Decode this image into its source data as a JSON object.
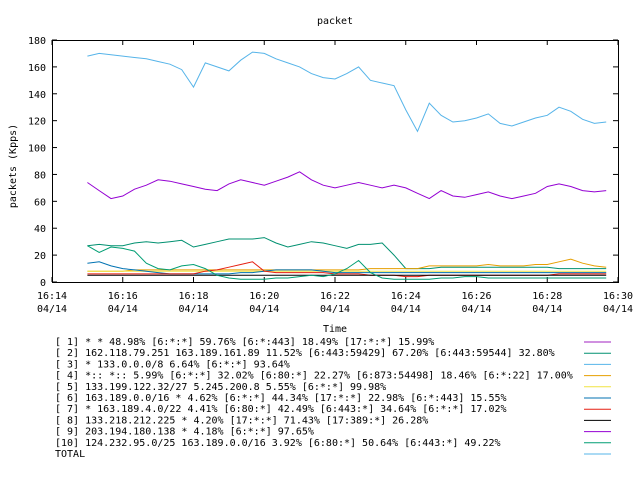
{
  "chart_data": {
    "type": "line",
    "title": "packet",
    "xlabel": "Time",
    "ylabel": "packets (Kpps)",
    "ylim": [
      0,
      180
    ],
    "yticks": [
      0,
      20,
      40,
      60,
      80,
      100,
      120,
      140,
      160,
      180
    ],
    "xlim": [
      "16:14",
      "16:30"
    ],
    "xticks": [
      {
        "time": "16:14",
        "date": "04/14"
      },
      {
        "time": "16:16",
        "date": "04/14"
      },
      {
        "time": "16:18",
        "date": "04/14"
      },
      {
        "time": "16:20",
        "date": "04/14"
      },
      {
        "time": "16:22",
        "date": "04/14"
      },
      {
        "time": "16:24",
        "date": "04/14"
      },
      {
        "time": "16:26",
        "date": "04/14"
      },
      {
        "time": "16:28",
        "date": "04/14"
      },
      {
        "time": "16:30",
        "date": "04/14"
      }
    ],
    "grid": false,
    "legend_position": "bottom",
    "x": [
      "16:15:00",
      "16:15:20",
      "16:15:40",
      "16:16:00",
      "16:16:20",
      "16:16:40",
      "16:17:00",
      "16:17:20",
      "16:17:40",
      "16:18:00",
      "16:18:20",
      "16:18:40",
      "16:19:00",
      "16:19:20",
      "16:19:40",
      "16:20:00",
      "16:20:20",
      "16:20:40",
      "16:21:00",
      "16:21:20",
      "16:21:40",
      "16:22:00",
      "16:22:20",
      "16:22:40",
      "16:23:00",
      "16:23:20",
      "16:23:40",
      "16:24:00",
      "16:24:20",
      "16:24:40",
      "16:25:00",
      "16:25:20",
      "16:25:40",
      "16:26:00",
      "16:26:20",
      "16:26:40",
      "16:27:00",
      "16:27:20",
      "16:27:40",
      "16:28:00",
      "16:28:20",
      "16:28:40",
      "16:29:00",
      "16:29:20",
      "16:29:40"
    ],
    "series": [
      {
        "name": "[ 1] * * 48.98%  [6:*:*] 59.76% [6:*:443] 18.49% [17:*:*] 15.99%",
        "color": "#a020c0",
        "values": [
          null,
          null,
          null,
          null,
          null,
          null,
          null,
          null,
          null,
          null,
          null,
          null,
          null,
          null,
          null,
          null,
          null,
          null,
          null,
          null,
          null,
          null,
          null,
          null,
          null,
          null,
          null,
          null,
          null,
          null,
          null,
          null,
          null,
          null,
          null,
          null,
          null,
          null,
          null,
          null,
          null,
          null,
          null,
          null,
          null
        ]
      },
      {
        "name": "[ 2] 162.118.79.251 163.189.161.89 11.52%  [6:443:59429] 67.20% [6:443:59544] 32.80%",
        "color": "#009070",
        "values": [
          27,
          28,
          27,
          27,
          29,
          30,
          29,
          30,
          31,
          26,
          28,
          30,
          32,
          32,
          32,
          33,
          29,
          26,
          28,
          30,
          29,
          27,
          25,
          28,
          28,
          29,
          20,
          10,
          10,
          10,
          11,
          11,
          11,
          11,
          11,
          11,
          11,
          11,
          11,
          11,
          10,
          10,
          10,
          10,
          10
        ]
      },
      {
        "name": "[ 3] * 133.0.0.0/8 6.64%  [6:*:*] 93.64%",
        "color": "#56b4e9",
        "values": [
          168,
          170,
          169,
          168,
          167,
          166,
          164,
          162,
          158,
          145,
          163,
          160,
          157,
          165,
          171,
          170,
          166,
          163,
          160,
          155,
          152,
          151,
          155,
          160,
          150,
          148,
          146,
          128,
          112,
          133,
          124,
          119,
          120,
          122,
          125,
          118,
          116,
          119,
          122,
          124,
          130,
          127,
          121,
          118,
          119
        ]
      },
      {
        "name": "[ 4] *:: *:: 5.99%  [6:*:*] 32.02% [6:80:*] 22.27% [6:873:54498] 18.46% [6:*:22] 17.00%",
        "color": "#e69f00",
        "values": [
          8,
          8,
          8,
          8,
          9,
          9,
          9,
          9,
          9,
          9,
          9,
          9,
          9,
          9,
          9,
          9,
          9,
          9,
          9,
          9,
          9,
          9,
          9,
          9,
          10,
          10,
          10,
          10,
          10,
          12,
          12,
          12,
          12,
          12,
          13,
          12,
          12,
          12,
          13,
          13,
          15,
          17,
          14,
          12,
          11
        ]
      },
      {
        "name": "[ 5] 133.199.122.32/27 5.245.200.8 5.55%  [6:*:*] 99.98%",
        "color": "#f0e442",
        "values": [
          8,
          8,
          8,
          8,
          8,
          8,
          8,
          8,
          8,
          8,
          8,
          8,
          8,
          8,
          8,
          8,
          8,
          8,
          8,
          8,
          8,
          8,
          8,
          8,
          8,
          8,
          8,
          8,
          8,
          8,
          8,
          8,
          8,
          8,
          8,
          8,
          8,
          8,
          8,
          8,
          8,
          8,
          8,
          8,
          8
        ]
      },
      {
        "name": "[ 6] 163.189.0.0/16 * 4.62%  [6:*:*] 44.34% [17:*:*] 22.98% [6:*:443] 15.55%",
        "color": "#0072b2",
        "values": [
          14,
          15,
          12,
          10,
          9,
          8,
          7,
          6,
          6,
          6,
          6,
          6,
          6,
          7,
          7,
          8,
          9,
          9,
          9,
          9,
          8,
          7,
          7,
          7,
          7,
          7,
          7,
          7,
          7,
          7,
          7,
          7,
          7,
          7,
          7,
          7,
          7,
          7,
          7,
          7,
          7,
          7,
          7,
          7,
          7
        ]
      },
      {
        "name": "[ 7] * 163.189.4.0/22 4.41%  [6:80:*] 42.49% [6:443:*] 34.64% [6:*:*] 17.02%",
        "color": "#e51e10",
        "values": [
          6,
          6,
          6,
          6,
          6,
          6,
          6,
          6,
          6,
          6,
          8,
          9,
          11,
          13,
          15,
          8,
          7,
          7,
          7,
          7,
          7,
          6,
          6,
          6,
          5,
          5,
          5,
          4,
          4,
          5,
          5,
          5,
          5,
          5,
          5,
          5,
          5,
          5,
          5,
          5,
          6,
          6,
          6,
          6,
          6
        ]
      },
      {
        "name": "[ 8] 133.218.212.225 * 4.20%  [17:*:*] 71.43% [17:389:*] 26.28%",
        "color": "#000000",
        "values": [
          5,
          5,
          5,
          5,
          5,
          5,
          5,
          5,
          5,
          5,
          5,
          5,
          5,
          5,
          5,
          5,
          5,
          5,
          5,
          5,
          5,
          5,
          5,
          5,
          5,
          5,
          5,
          5,
          5,
          5,
          5,
          5,
          5,
          5,
          5,
          5,
          5,
          5,
          5,
          5,
          5,
          5,
          5,
          5,
          5
        ]
      },
      {
        "name": "[ 9] 203.194.180.138 * 4.18%  [6:*:*] 97.65%",
        "color": "#9400d3",
        "values": [
          74,
          68,
          62,
          64,
          69,
          72,
          76,
          75,
          73,
          71,
          69,
          68,
          73,
          76,
          74,
          72,
          75,
          78,
          82,
          76,
          72,
          70,
          72,
          74,
          72,
          70,
          72,
          70,
          66,
          62,
          68,
          64,
          63,
          65,
          67,
          64,
          62,
          64,
          66,
          71,
          73,
          71,
          68,
          67,
          68
        ]
      },
      {
        "name": "[10] 124.232.95.0/25 163.189.0.0/16 3.92%  [6:80:*] 50.64% [6:443:*] 49.22%",
        "color": "#009e73",
        "values": [
          27,
          22,
          26,
          25,
          23,
          14,
          10,
          9,
          12,
          13,
          10,
          5,
          3,
          2,
          2,
          2,
          3,
          3,
          4,
          5,
          4,
          6,
          10,
          16,
          7,
          3,
          2,
          2,
          2,
          2,
          3,
          3,
          4,
          4,
          3,
          3,
          3,
          3,
          3,
          3,
          3,
          3,
          3,
          3,
          3
        ]
      },
      {
        "name": "TOTAL",
        "color": "#56b4e9",
        "values": [
          null,
          null,
          null,
          null,
          null,
          null,
          null,
          null,
          null,
          null,
          null,
          null,
          null,
          null,
          null,
          null,
          null,
          null,
          null,
          null,
          null,
          null,
          null,
          null,
          null,
          null,
          null,
          null,
          null,
          null,
          null,
          null,
          null,
          null,
          null,
          null,
          null,
          null,
          null,
          null,
          null,
          null,
          null,
          null,
          null
        ]
      }
    ]
  }
}
